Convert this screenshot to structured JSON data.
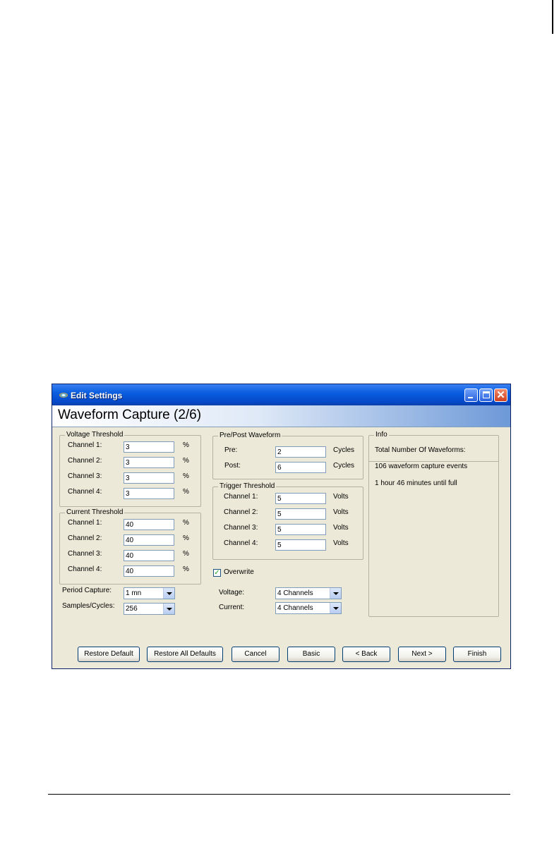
{
  "window": {
    "title": "Edit Settings",
    "page_title": "Waveform Capture (2/6)",
    "close_glyph": "✕"
  },
  "voltage_threshold": {
    "label": "Voltage Threshold",
    "rows": [
      {
        "label": "Channel 1:",
        "value": "3",
        "unit": "%"
      },
      {
        "label": "Channel 2:",
        "value": "3",
        "unit": "%"
      },
      {
        "label": "Channel 3:",
        "value": "3",
        "unit": "%"
      },
      {
        "label": "Channel 4:",
        "value": "3",
        "unit": "%"
      }
    ]
  },
  "current_threshold": {
    "label": "Current Threshold",
    "rows": [
      {
        "label": "Channel 1:",
        "value": "40",
        "unit": "%"
      },
      {
        "label": "Channel 2:",
        "value": "40",
        "unit": "%"
      },
      {
        "label": "Channel 3:",
        "value": "40",
        "unit": "%"
      },
      {
        "label": "Channel 4:",
        "value": "40",
        "unit": "%"
      }
    ]
  },
  "period_capture": {
    "label": "Period Capture:",
    "value": "1 mn"
  },
  "samples_cycles": {
    "label": "Samples/Cycles:",
    "value": "256"
  },
  "pre_post": {
    "label": "Pre/Post Waveform",
    "rows": [
      {
        "label": "Pre:",
        "value": "2",
        "unit": "Cycles"
      },
      {
        "label": "Post:",
        "value": "6",
        "unit": "Cycles"
      }
    ]
  },
  "trigger_threshold": {
    "label": "Trigger Threshold",
    "rows": [
      {
        "label": "Channel 1:",
        "value": "5",
        "unit": "Volts"
      },
      {
        "label": "Channel 2:",
        "value": "5",
        "unit": "Volts"
      },
      {
        "label": "Channel 3:",
        "value": "5",
        "unit": "Volts"
      },
      {
        "label": "Channel 4:",
        "value": "5",
        "unit": "Volts"
      }
    ]
  },
  "overwrite": {
    "label": "Overwrite",
    "checked": true,
    "check_glyph": "✓"
  },
  "voltage": {
    "label": "Voltage:",
    "value": "4 Channels"
  },
  "current": {
    "label": "Current:",
    "value": "4 Channels"
  },
  "info": {
    "label": "Info",
    "heading": "Total Number Of Waveforms:",
    "events": "106 waveform capture events",
    "time_until_full": "1 hour 46 minutes until full"
  },
  "buttons": {
    "restore_default": "Restore Default",
    "restore_all_defaults": "Restore All Defaults",
    "cancel": "Cancel",
    "basic": "Basic",
    "back": "< Back",
    "next": "Next >",
    "finish": "Finish"
  }
}
